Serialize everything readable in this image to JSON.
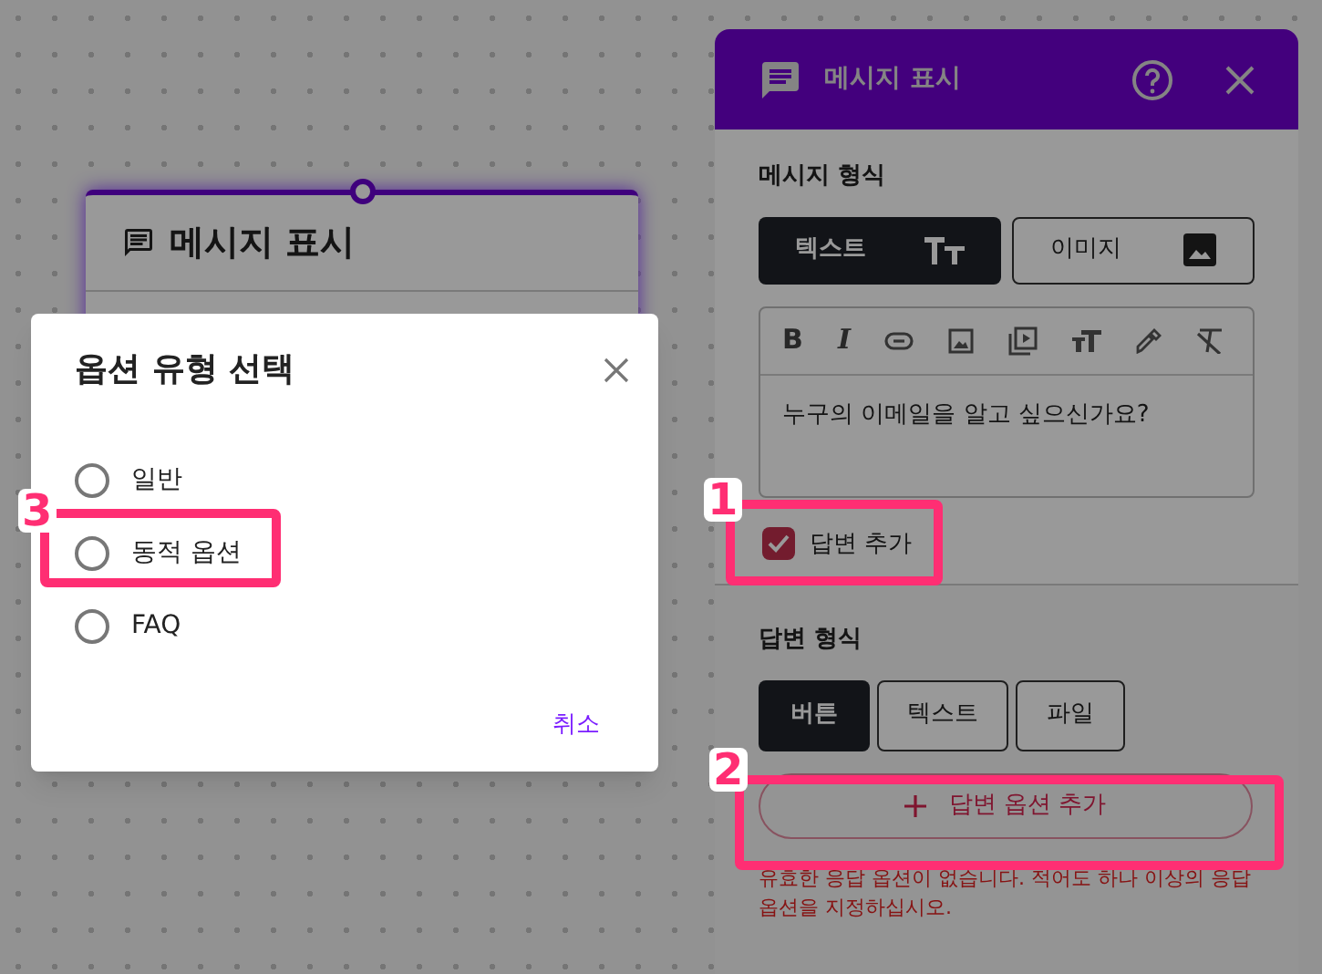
{
  "canvas": {
    "node": {
      "title": "메시지 표시"
    }
  },
  "panel": {
    "title": "메시지 표시",
    "message_format": {
      "label": "메시지 형식",
      "options": [
        {
          "label": "텍스트",
          "kind": "text",
          "selected": true
        },
        {
          "label": "이미지",
          "kind": "image",
          "selected": false
        }
      ]
    },
    "editor": {
      "toolbar_glyphs": [
        "B",
        "I"
      ],
      "text": "누구의 이메일을 알고 싶으신가요?"
    },
    "add_answer": {
      "label": "답변 추가",
      "checked": true
    },
    "answer_format": {
      "label": "답변 형식",
      "options": [
        {
          "label": "버튼",
          "selected": true
        },
        {
          "label": "텍스트",
          "selected": false
        },
        {
          "label": "파일",
          "selected": false
        }
      ]
    },
    "add_option_button": "답변 옵션 추가",
    "error": "유효한 응답 옵션이 없습니다. 적어도 하나 이상의 응답 옵션을 지정하십시오."
  },
  "dialog": {
    "title": "옵션 유형 선택",
    "options": [
      {
        "label": "일반",
        "selected": false
      },
      {
        "label": "동적 옵션",
        "selected": false
      },
      {
        "label": "FAQ",
        "selected": false
      }
    ],
    "cancel": "취소"
  },
  "annotations": [
    {
      "label": "1"
    },
    {
      "label": "2"
    },
    {
      "label": "3"
    }
  ]
}
